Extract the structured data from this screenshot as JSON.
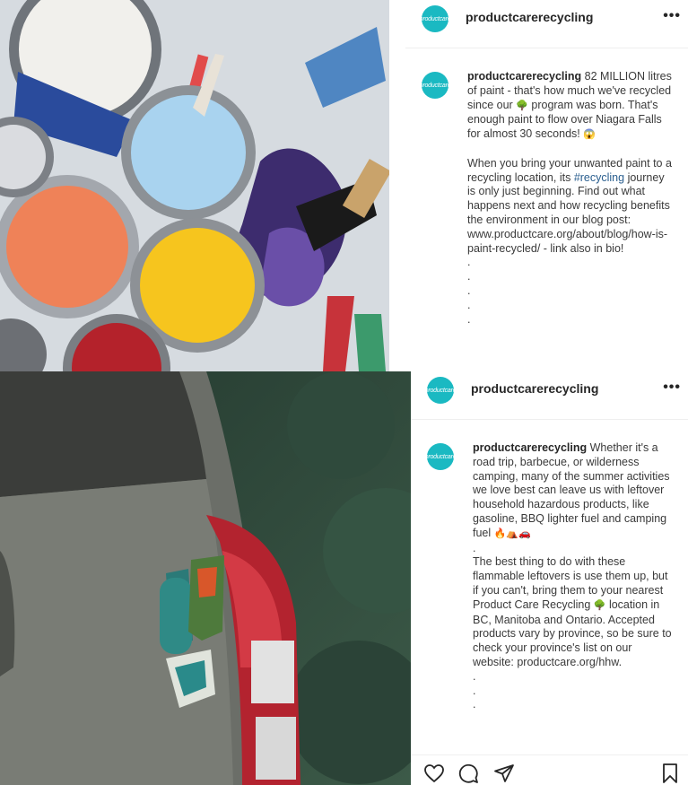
{
  "post1": {
    "username": "productcarerecycling",
    "avatar_text": "productcare",
    "more_label": "•••",
    "caption": {
      "username": "productcarerecycling",
      "p1": " 82 MILLION litres of paint - that's how much we've recycled since our ",
      "emoji_tree": "🌳",
      "p1b": " program was born. That's enough paint to flow over Niagara Falls for almost 30 seconds! ",
      "emoji_face": "😱",
      "p2a": "\n\nWhen you bring your unwanted paint to a recycling location, its ",
      "hashtag": "#recycling",
      "p2b": " journey is only just beginning. Find out what happens next and how recycling benefits the environment in our blog post: www.productcare.org/about/blog/how-is-paint-recycled/ - link also in bio!",
      "dots": "\n.\n.\n.\n.\n."
    }
  },
  "post2": {
    "username": "productcarerecycling",
    "avatar_text": "productcare",
    "more_label": "•••",
    "caption": {
      "username": "productcarerecycling",
      "p1": " Whether it's a road trip, barbecue, or wilderness camping, many of the summer activities we love best can leave us with leftover household hazardous products, like gasoline, BBQ lighter fuel and camping fuel ",
      "emojis1": "🔥⛺🚗",
      "p2a": "\n.\nThe best thing to do with these flammable leftovers is use them up, but if you can't, bring them to your nearest Product Care Recycling ",
      "emoji_tree": "🌳",
      "p2b": " location in BC, Manitoba and Ontario. Accepted products vary by province, so be sure to check your province's list on our website: productcare.org/hhw.",
      "dots": "\n.\n.\n."
    }
  },
  "actions": {
    "like": "heart-icon",
    "comment": "comment-icon",
    "share": "share-icon",
    "save": "bookmark-icon"
  },
  "colors": {
    "brand_teal": "#1ab9c2",
    "hashtag": "#2b5f8f",
    "text": "#262626"
  }
}
